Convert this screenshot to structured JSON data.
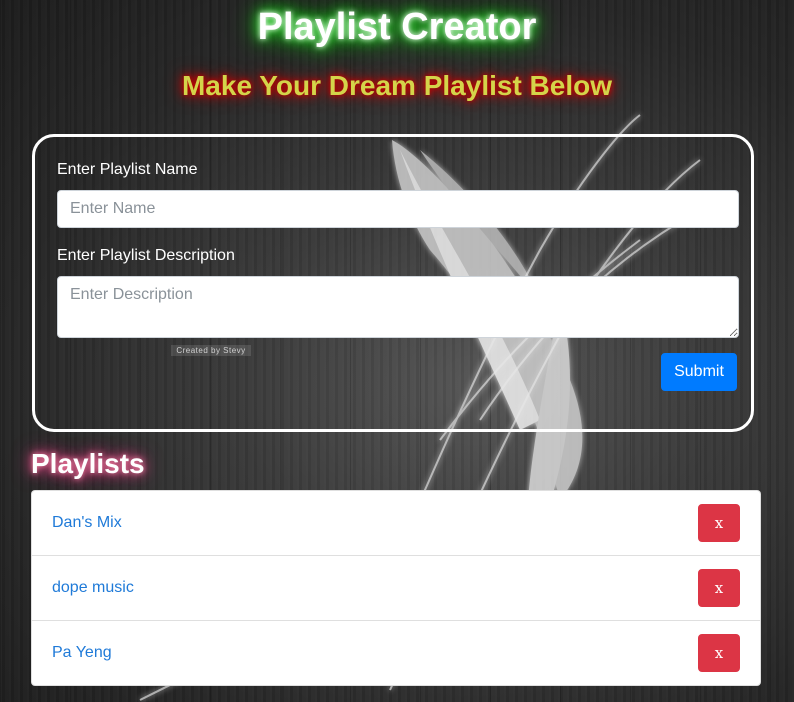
{
  "header": {
    "title": "Playlist Creator",
    "subtitle": "Make Your Dream Playlist Below"
  },
  "form": {
    "name_label": "Enter Playlist Name",
    "name_placeholder": "Enter Name",
    "name_value": "",
    "description_label": "Enter Playlist Description",
    "description_placeholder": "Enter Description",
    "description_value": "",
    "credit_text": "Created by Stevy",
    "submit_label": "Submit"
  },
  "playlists": {
    "heading": "Playlists",
    "items": [
      {
        "name": "Dan's Mix",
        "delete_label": "x"
      },
      {
        "name": "dope music",
        "delete_label": "x"
      },
      {
        "name": "Pa Yeng",
        "delete_label": "x"
      }
    ]
  },
  "colors": {
    "submit_button": "#007bff",
    "delete_button": "#dc3545",
    "link": "#1f7ad8",
    "title_glow": "#33ff33",
    "subtitle_glow": "#dd0000",
    "heading_glow": "#ee4488"
  }
}
